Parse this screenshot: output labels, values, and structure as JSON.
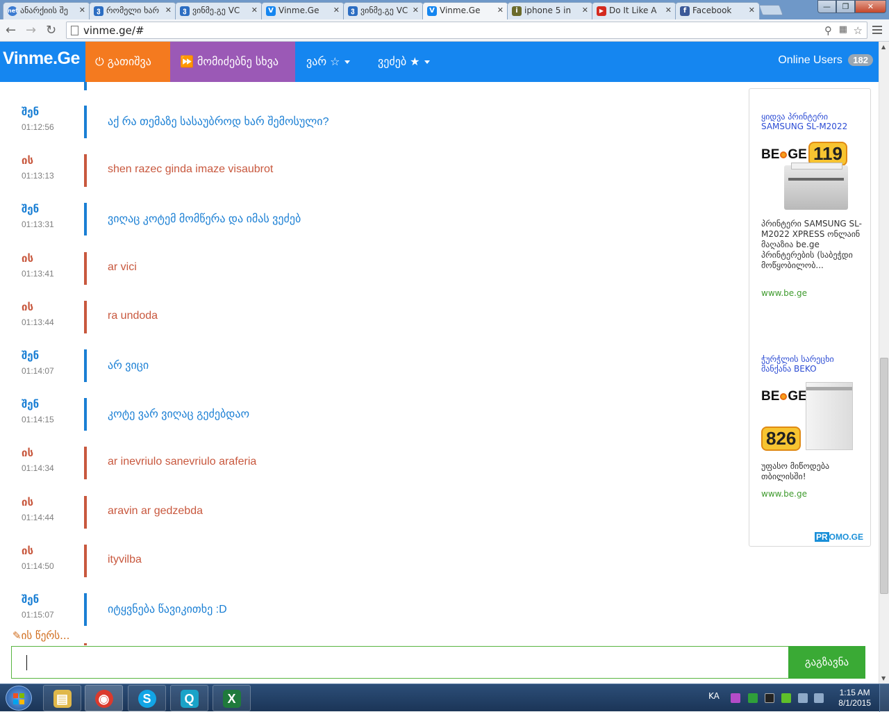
{
  "browser": {
    "tabs": [
      {
        "label": "ანარქიის შე",
        "favicon": "net",
        "color": "#3b7bd1"
      },
      {
        "label": "რომელი ხარ",
        "favicon": "ვ",
        "color": "#2b6dc2"
      },
      {
        "label": "ვინმე.გე VC",
        "favicon": "ვ",
        "color": "#2b6dc2"
      },
      {
        "label": "Vinme.Ge",
        "favicon": "V",
        "color": "#1586f0"
      },
      {
        "label": "ვინმე.გე VC",
        "favicon": "ვ",
        "color": "#2b6dc2"
      },
      {
        "label": "Vinme.Ge",
        "favicon": "V",
        "color": "#1586f0"
      },
      {
        "label": "iphone 5 in",
        "favicon": "i",
        "color": "#6b6b2b"
      },
      {
        "label": "Do It Like A",
        "favicon": "▶",
        "color": "#d42a1f"
      },
      {
        "label": "Facebook",
        "favicon": "f",
        "color": "#3b5998"
      }
    ],
    "close_glyph": "✕",
    "url": "vinme.ge/#",
    "window_buttons": {
      "minimize": "—",
      "maximize": "❐",
      "close": "✕"
    }
  },
  "site": {
    "logo": "Vinme.Ge",
    "nav": {
      "disconnect": "⏻ გათიშვა",
      "next": "⏩ მომიძებნე სხვა",
      "male": "ვარ ☆",
      "female": "ვეძებ ★"
    },
    "online_label": "Online Users",
    "online_count": "182"
  },
  "chat": {
    "messages": [
      {
        "who": "შენ",
        "time": "01:12:56",
        "text": "აქ რა თემაზე სასაუბროდ ხარ შემოსული?",
        "side": "me"
      },
      {
        "who": "ის",
        "time": "01:13:13",
        "text": "shen razec ginda imaze visaubrot",
        "side": "them"
      },
      {
        "who": "შენ",
        "time": "01:13:31",
        "text": "ვიღაც კოტემ მომწერა და იმას ვეძებ",
        "side": "me"
      },
      {
        "who": "ის",
        "time": "01:13:41",
        "text": "ar vici",
        "side": "them"
      },
      {
        "who": "ის",
        "time": "01:13:44",
        "text": "ra undoda",
        "side": "them"
      },
      {
        "who": "შენ",
        "time": "01:14:07",
        "text": "არ ვიცი",
        "side": "me"
      },
      {
        "who": "შენ",
        "time": "01:14:15",
        "text": "კოტე ვარ ვიღაც გეძებდაო",
        "side": "me"
      },
      {
        "who": "ის",
        "time": "01:14:34",
        "text": "ar inevriulo sanevriulo araferia",
        "side": "them"
      },
      {
        "who": "ის",
        "time": "01:14:44",
        "text": "aravin ar gedzebda",
        "side": "them"
      },
      {
        "who": "ის",
        "time": "01:14:50",
        "text": "ityvilba",
        "side": "them"
      },
      {
        "who": "შენ",
        "time": "01:15:07",
        "text": "იტყვნება წავიკითხე :D",
        "side": "me"
      }
    ],
    "typing": "✎ის წერს...",
    "input_value": "",
    "send_label": "გაგზავნა"
  },
  "ads": {
    "items": [
      {
        "title": "ყიდვა პრინტერი SAMSUNG SL-M2022",
        "brand": "BE•GE",
        "price": "119",
        "description": "პრინტერი SAMSUNG SL-M2022 XPRESS ონლაინ მაღაზია be.ge პრინტერების (საბეჭდი მოწყობილობ...",
        "url": "www.be.ge"
      },
      {
        "title": "ჭურჭლის სარეცხი მანქანა BEKO",
        "brand": "BE•GE",
        "price": "826",
        "description": "უფასო მიწოდება თბილისში!",
        "url": "www.be.ge"
      }
    ],
    "promo": {
      "prefix": "PR",
      "suffix": "OMO.GE"
    }
  },
  "taskbar": {
    "apps": [
      {
        "name": "explorer",
        "glyph": "▤",
        "color": "#e0b84a"
      },
      {
        "name": "chrome",
        "glyph": "◉",
        "color": "#db3a2d"
      },
      {
        "name": "skype",
        "glyph": "S",
        "color": "#12a5e6"
      },
      {
        "name": "qip",
        "glyph": "Q",
        "color": "#1aa3c8"
      },
      {
        "name": "excel",
        "glyph": "X",
        "color": "#1f7a3c"
      }
    ],
    "language": "KA",
    "time": "1:15 AM",
    "date": "8/1/2015"
  }
}
